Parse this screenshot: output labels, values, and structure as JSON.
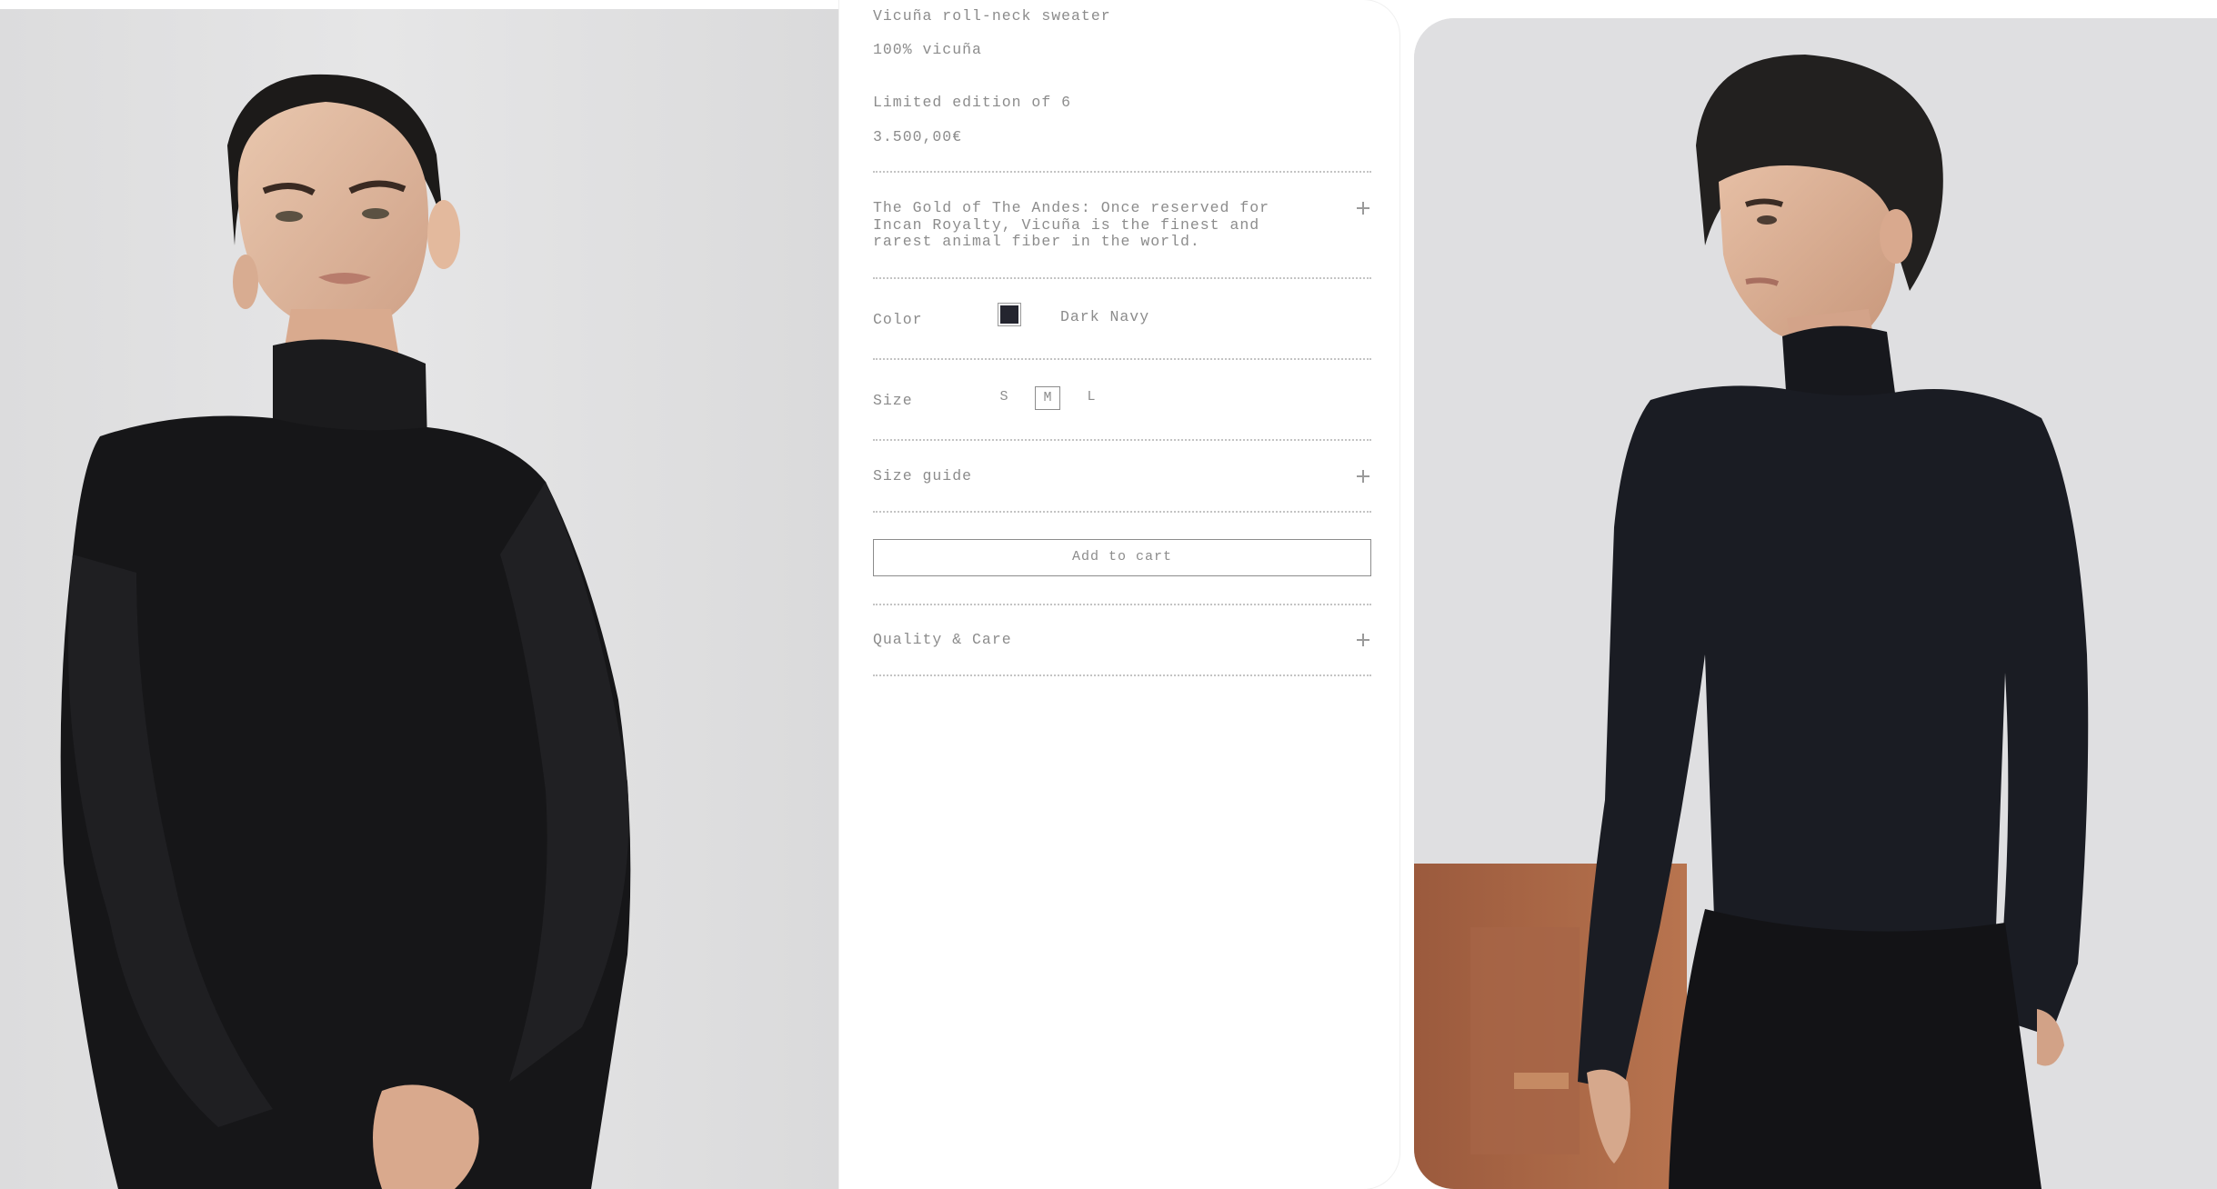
{
  "product": {
    "name": "Vicuña roll-neck sweater",
    "composition": "100% vicuña",
    "edition": "Limited edition of 6",
    "price": "3.500,00€",
    "description": "The Gold of The Andes: Once reserved for Incan Royalty, Vicuña is the finest and rarest animal fiber in the world."
  },
  "color": {
    "label": "Color",
    "selected_name": "Dark Navy",
    "swatch_hex": "#24252f"
  },
  "size": {
    "label": "Size",
    "options": [
      "S",
      "M",
      "L"
    ],
    "selected": "M"
  },
  "size_guide": {
    "label": "Size guide"
  },
  "cart": {
    "button_label": "Add to cart"
  },
  "quality_care": {
    "label": "Quality & Care"
  },
  "icons": {
    "expand": "plus-icon"
  },
  "images": {
    "left": "model-woman-black-roll-neck-photo",
    "right": "model-man-navy-roll-neck-photo"
  }
}
